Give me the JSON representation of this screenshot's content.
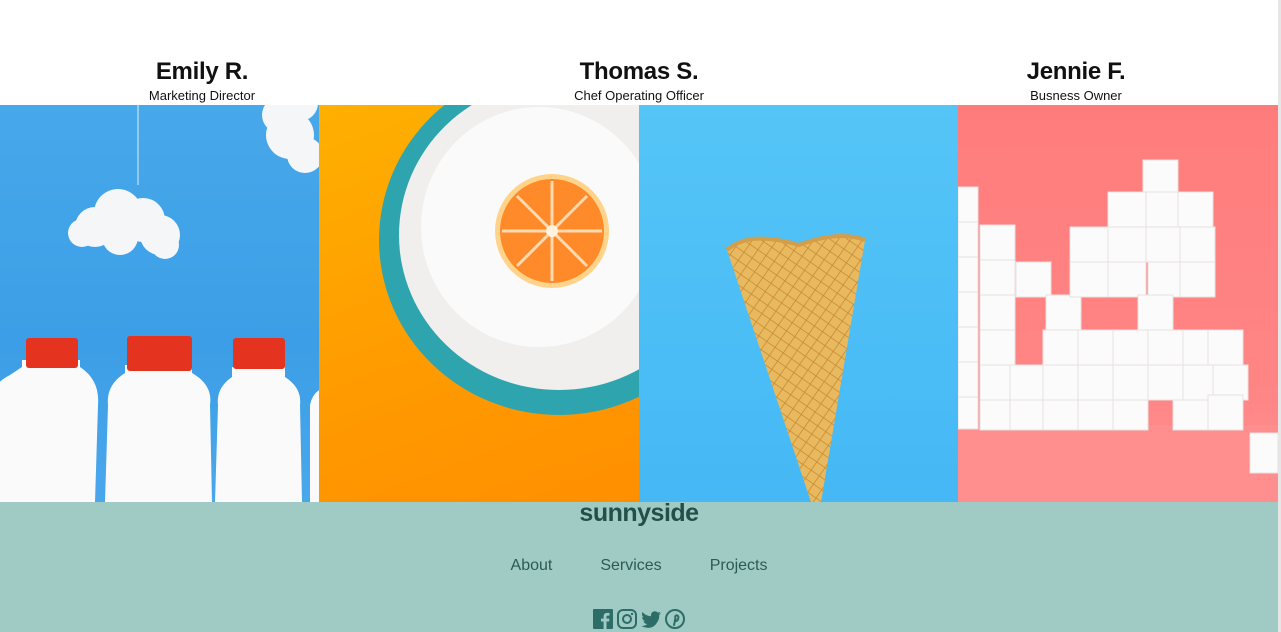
{
  "testimonials": [
    {
      "name": "Emily R.",
      "role": "Marketing Director"
    },
    {
      "name": "Thomas S.",
      "role": "Chef Operating Officer"
    },
    {
      "name": "Jennie F.",
      "role": "Busness Owner"
    }
  ],
  "gallery": [
    {
      "icon": "milk-bottles-image"
    },
    {
      "icon": "orange-plate-image"
    },
    {
      "icon": "ice-cream-cone-image"
    },
    {
      "icon": "sugar-cubes-image"
    }
  ],
  "footer": {
    "logo": "sunnyside",
    "nav": [
      "About",
      "Services",
      "Projects"
    ],
    "social_icons": [
      "facebook-icon",
      "instagram-icon",
      "twitter-icon",
      "pinterest-icon"
    ],
    "color": "#a0cac4"
  }
}
